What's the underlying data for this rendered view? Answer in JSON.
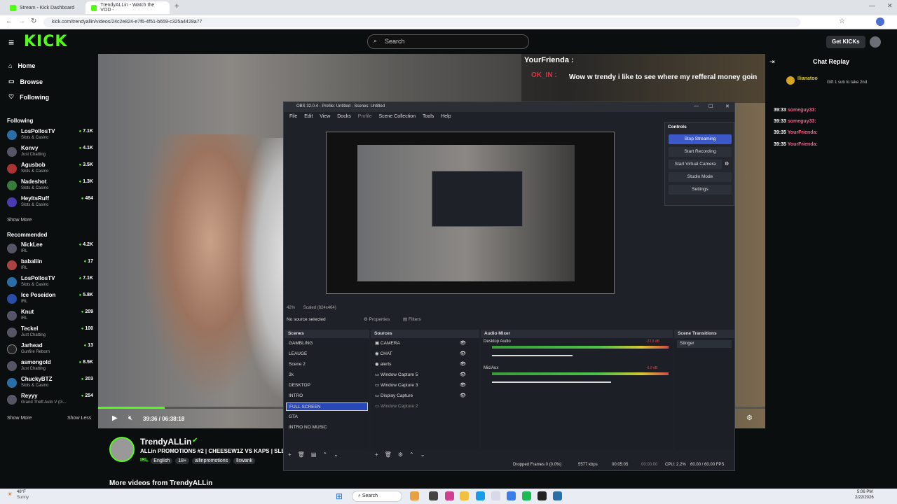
{
  "browser": {
    "tabs": [
      {
        "label": "Stream - Kick Dashboard"
      },
      {
        "label": "TrendyALLin - Watch the VOD -"
      }
    ],
    "url": "kick.com/trendyallin/videos/24c2e824-e7f6-4f51-b659-c325a4428a77"
  },
  "header": {
    "logo": "KICK",
    "search_placeholder": "Search",
    "get_kicks": "Get KICKs"
  },
  "sidebar": {
    "nav": [
      {
        "label": "Home"
      },
      {
        "label": "Browse"
      },
      {
        "label": "Following"
      }
    ],
    "following_title": "Following",
    "following": [
      {
        "name": "LosPollosTV",
        "category": "Slots & Casino",
        "viewers": "7.1K"
      },
      {
        "name": "Konvy",
        "category": "Just Chatting",
        "viewers": "4.1K"
      },
      {
        "name": "Agusbob",
        "category": "Slots & Casino",
        "viewers": "3.5K"
      },
      {
        "name": "Nadeshot",
        "category": "Slots & Casino",
        "viewers": "1.3K"
      },
      {
        "name": "HeyItsRuff",
        "category": "Slots & Casino",
        "viewers": "484"
      }
    ],
    "show_more": "Show More",
    "recommended_title": "Recommended",
    "recommended": [
      {
        "name": "NickLee",
        "category": "IRL",
        "viewers": "4.2K"
      },
      {
        "name": "babaliin",
        "category": "IRL",
        "viewers": "17"
      },
      {
        "name": "LosPollosTV",
        "category": "Slots & Casino",
        "viewers": "7.1K"
      },
      {
        "name": "Ice Poseidon",
        "category": "IRL",
        "viewers": "5.8K"
      },
      {
        "name": "Knut",
        "category": "IRL",
        "viewers": "209"
      },
      {
        "name": "Teckel",
        "category": "Just Chatting",
        "viewers": "100"
      },
      {
        "name": "Jarhead",
        "category": "Gunfire Reborn",
        "viewers": "13"
      },
      {
        "name": "asmongold",
        "category": "Just Chatting",
        "viewers": "8.5K"
      },
      {
        "name": "ChuckyBTZ",
        "category": "Slots & Casino",
        "viewers": "203"
      },
      {
        "name": "Reyyy",
        "category": "Grand Theft Auto V (G...",
        "viewers": "254"
      }
    ],
    "show_more_2": "Show More",
    "show_less": "Show Less"
  },
  "video": {
    "time": "39:36 / 06:38:18",
    "progress": 0.1,
    "overlay_chat": {
      "user": "YourFrienda :",
      "user2": "OK_IN :",
      "message": "Wow w trendy i like to see where my refferal money goin"
    }
  },
  "streamer": {
    "name": "TrendyALLin",
    "title": "ALLin PROMOTIONS #2 | CHEESEW1Z VS KAPS | SLE",
    "tags": [
      "IRL",
      "English",
      "18+",
      "allinpromotions",
      "llswank"
    ],
    "more_videos": "More videos from TrendyALLin"
  },
  "chat": {
    "title": "Chat Replay",
    "gift_user": "Ilianatoo",
    "gift_text": "Gift 1 sub to take 2nd",
    "messages": [
      {
        "time": "39:33",
        "user": "someguy33:",
        "color": "#ff5c8a"
      },
      {
        "time": "39:33",
        "user": "someguy33:",
        "color": "#ff5c8a"
      },
      {
        "time": "39:35",
        "user": "YourFrienda:",
        "color": "#ff5c8a"
      },
      {
        "time": "39:35",
        "user": "YourFrienda:",
        "color": "#ff5c8a"
      }
    ]
  },
  "obs": {
    "title": "OBS 32.0.4 - Profile: Untitled - Scenes: Untitled",
    "menu": [
      "File",
      "Edit",
      "View",
      "Docks",
      "Profile",
      "Scene Collection",
      "Tools",
      "Help"
    ],
    "zoom": "42%",
    "scaled": "Scaled (824x464)",
    "no_source": "No source selected",
    "properties": "Properties",
    "filters": "Filters",
    "controls_title": "Controls",
    "controls": [
      "Stop Streaming",
      "Start Recording",
      "Start Virtual Camera",
      "Studio Mode",
      "Settings"
    ],
    "scenes_title": "Scenes",
    "scenes": [
      "GAMBLING",
      "LEAUGE",
      "Scene 2",
      "2k",
      "DESKTOP",
      "INTRO",
      "FULL SCREEN",
      "GTA",
      "INTRO NO MUSIC"
    ],
    "selected_scene": "FULL SCREEN",
    "sources_title": "Sources",
    "sources": [
      "CAMERA",
      "CHAT",
      "alerts",
      "Window Capture 5",
      "Window Capture 3",
      "Display Capture",
      "Window Capture 2"
    ],
    "mixer_title": "Audio Mixer",
    "mixer": [
      {
        "name": "Desktop Audio",
        "db": "-22.9 dB"
      },
      {
        "name": "Mic/Aux",
        "db": "-6.9 dB"
      }
    ],
    "transitions_title": "Scene Transitions",
    "transition": "Stinger",
    "status": {
      "dropped": "Dropped Frames 0 (0.0%)",
      "kbps": "5577 kbps",
      "stream_time": "00:05:05",
      "rec_time": "00:00:00",
      "cpu": "CPU: 2.2%",
      "fps": "60.00 / 60.00 FPS"
    }
  },
  "taskbar": {
    "weather": "48°F",
    "weather2": "Sunny",
    "search": "Search",
    "time": "5:06 PM",
    "date": "2/22/2026"
  },
  "colors": {
    "kick_green": "#53fc18",
    "obs_blue": "#3c58c8"
  }
}
